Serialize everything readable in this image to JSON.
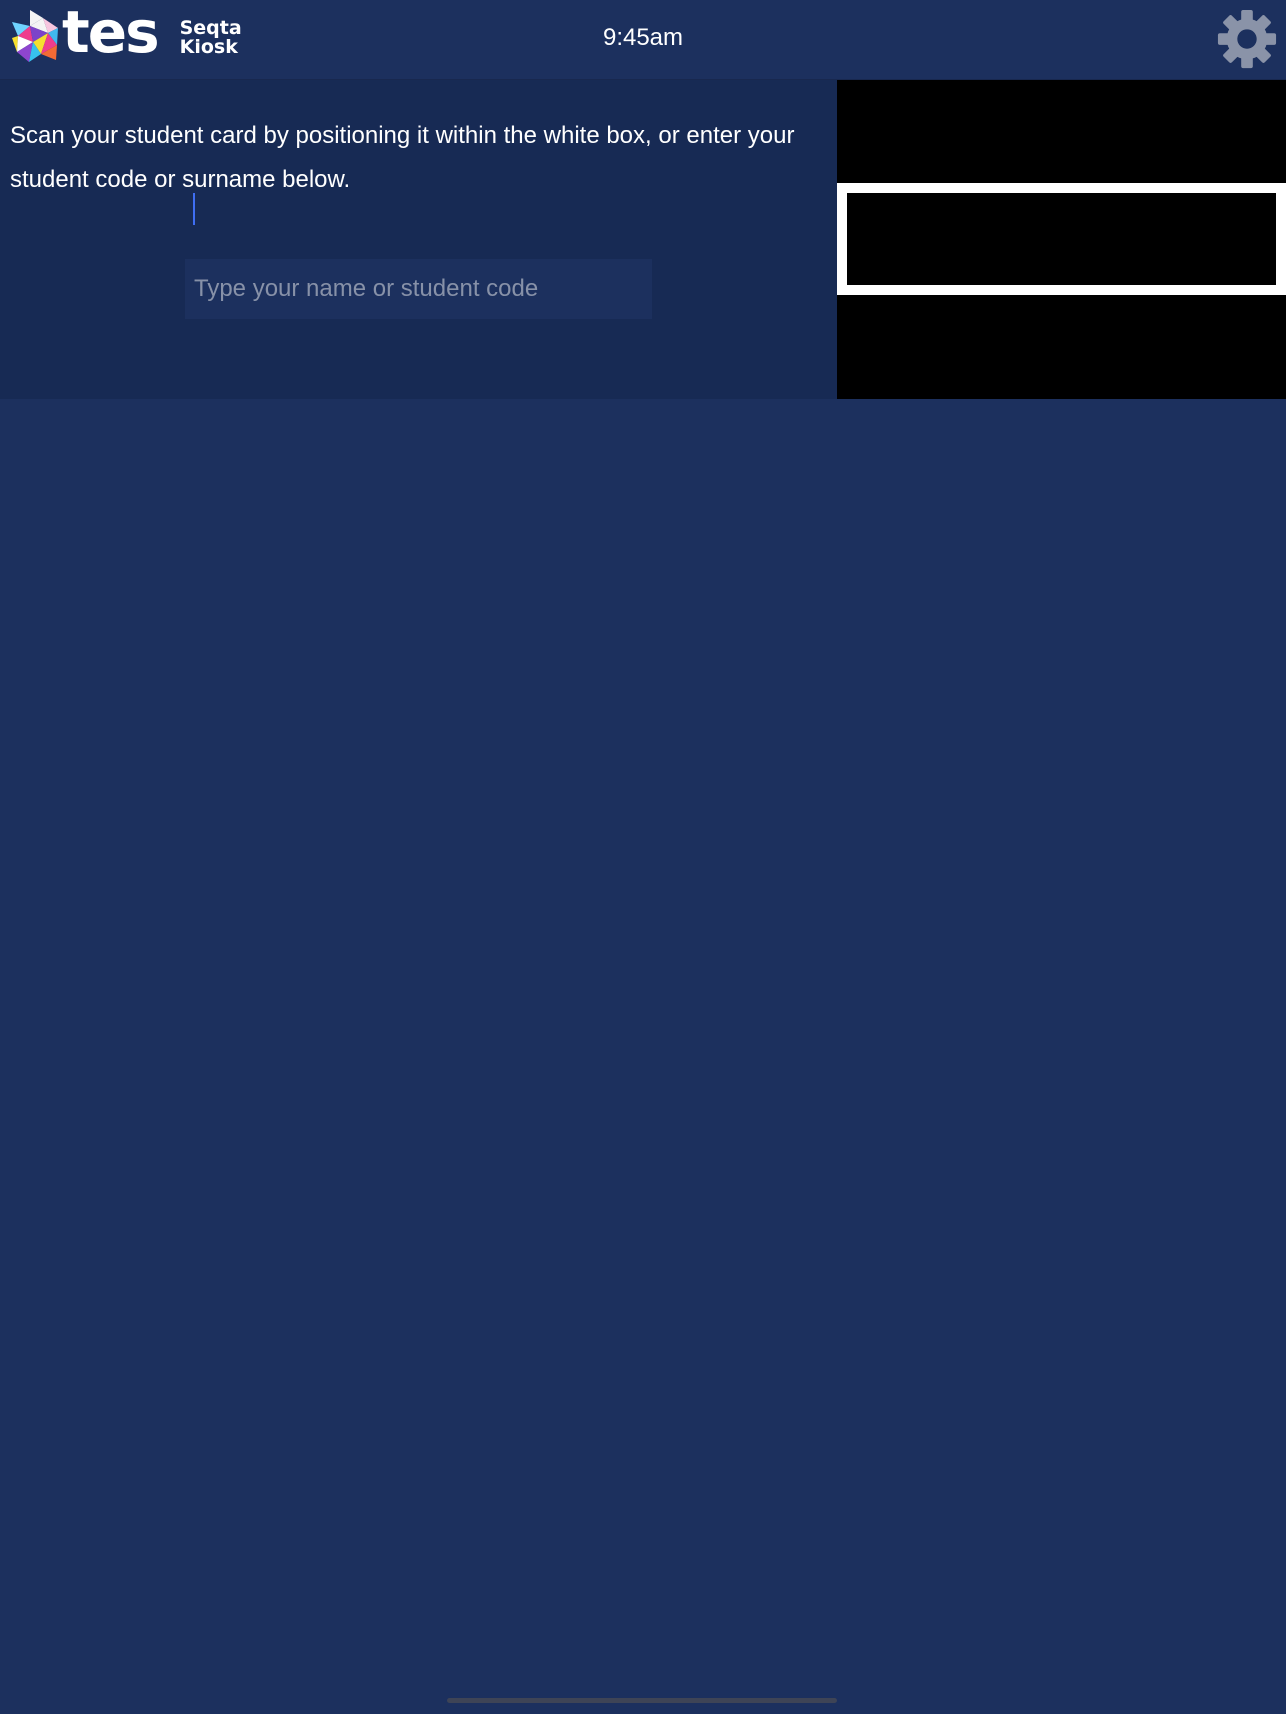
{
  "header": {
    "logo_text": "tes",
    "logo_subtitle_line1": "Seqta",
    "logo_subtitle_line2": "Kiosk",
    "time": "9:45am",
    "settings_icon": "gear-icon"
  },
  "scan": {
    "instructions": "Scan your student card by positioning it within the white box, or enter your student code or surname below.",
    "search_placeholder": "Type your name or student code",
    "search_value": ""
  },
  "colors": {
    "background": "#1c305e",
    "panel": "#172a54",
    "camera": "#000000",
    "scan_box": "#ffffff",
    "gear": "#8a93a8"
  }
}
